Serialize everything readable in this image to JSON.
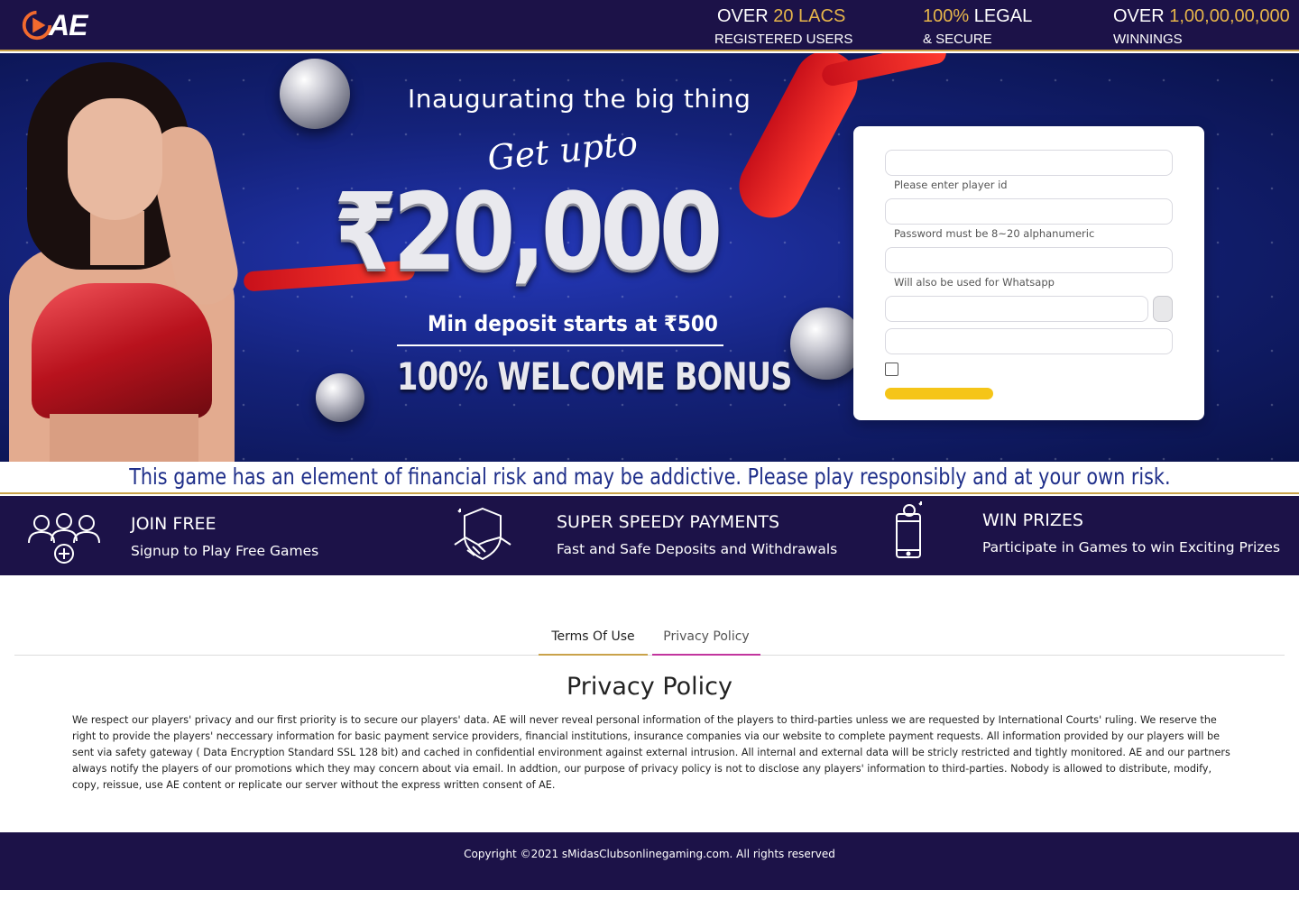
{
  "header": {
    "logo_text": "AE",
    "stats": [
      {
        "prefix": "OVER ",
        "highlight": "20 LACS",
        "suffix": "",
        "label": "REGISTERED USERS"
      },
      {
        "prefix": "",
        "highlight": "100%",
        "suffix": " LEGAL",
        "label": "& SECURE"
      },
      {
        "prefix": "OVER ",
        "highlight": "1,00,00,00,000",
        "suffix": "",
        "label": "WINNINGS"
      }
    ],
    "accent_color": "#e6b54a",
    "background_color": "#1c1248"
  },
  "banner": {
    "line1": "Inaugurating the big thing",
    "line2": "Get upto",
    "amount": "₹20,000",
    "min_deposit": "Min deposit starts at ₹500",
    "bonus": "100% WELCOME BONUS"
  },
  "form": {
    "player_id_hint": "Please enter player id",
    "password_hint": "Password must be 8~20 alphanumeric",
    "phone_hint": "Will also be used for Whatsapp",
    "submit_color": "#f5c518"
  },
  "risk_notice": "This game has an element of financial risk and may be addictive. Please play responsibly and at your own risk.",
  "features": [
    {
      "icon": "users-plus-icon",
      "title": "JOIN FREE",
      "subtitle": "Signup to Play Free Games"
    },
    {
      "icon": "shield-handshake-icon",
      "title": "SUPER SPEEDY PAYMENTS",
      "subtitle": "Fast and Safe Deposits and Withdrawals"
    },
    {
      "icon": "mobile-prize-icon",
      "title": "WIN PRIZES",
      "subtitle": "Participate in Games to win Exciting Prizes"
    }
  ],
  "tabs": [
    {
      "label": "Terms Of Use"
    },
    {
      "label": "Privacy Policy"
    }
  ],
  "privacy": {
    "title": "Privacy Policy",
    "body": "We respect our players' privacy and our first priority is to secure our players' data. AE will never reveal personal information of the players to third-parties unless we are requested by International Courts' ruling. We reserve the right to provide the players' neccessary information for basic payment service providers, financial institutions, insurance companies via our website to complete payment requests. All information provided by our players will be sent via safety gateway ( Data Encryption Standard SSL 128 bit) and cached in confidential environment against external intrusion. All internal and external data will be stricly restricted and tightly monitored. AE and our partners always notify the players of our promotions which they may concern about via email. In addtion, our purpose of privacy policy is not to disclose any players' information to third-parties. Nobody is allowed to distribute, modify, copy, reissue, use AE content or replicate our server without the express written consent of AE."
  },
  "footer": {
    "copyright": "Copyright ©2021 sMidasClubsonlinegaming.com. All rights reserved"
  }
}
